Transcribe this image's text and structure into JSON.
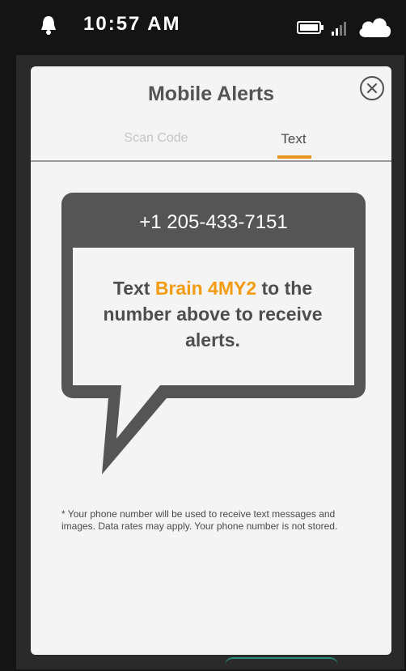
{
  "status_bar": {
    "time": "10:57 AM"
  },
  "modal": {
    "title": "Mobile Alerts",
    "tabs": [
      {
        "label": "Scan Code",
        "active": false
      },
      {
        "label": "Text",
        "active": true
      }
    ],
    "phone_number": "+1 205-433-7151",
    "message": {
      "prefix": "Text ",
      "code": "Brain 4MY2",
      "suffix": " to the number above to receive alerts."
    },
    "disclaimer": "* Your phone number will be used to receive text messages and images. Data rates may apply. Your phone number is not stored."
  },
  "colors": {
    "accent": "#f39c12",
    "tab_underline": "#e8961e",
    "bubble": "#555555",
    "background": "#141414"
  },
  "icons": [
    "bell-icon",
    "battery-icon",
    "signal-icon",
    "cloud-icon",
    "close-icon"
  ]
}
